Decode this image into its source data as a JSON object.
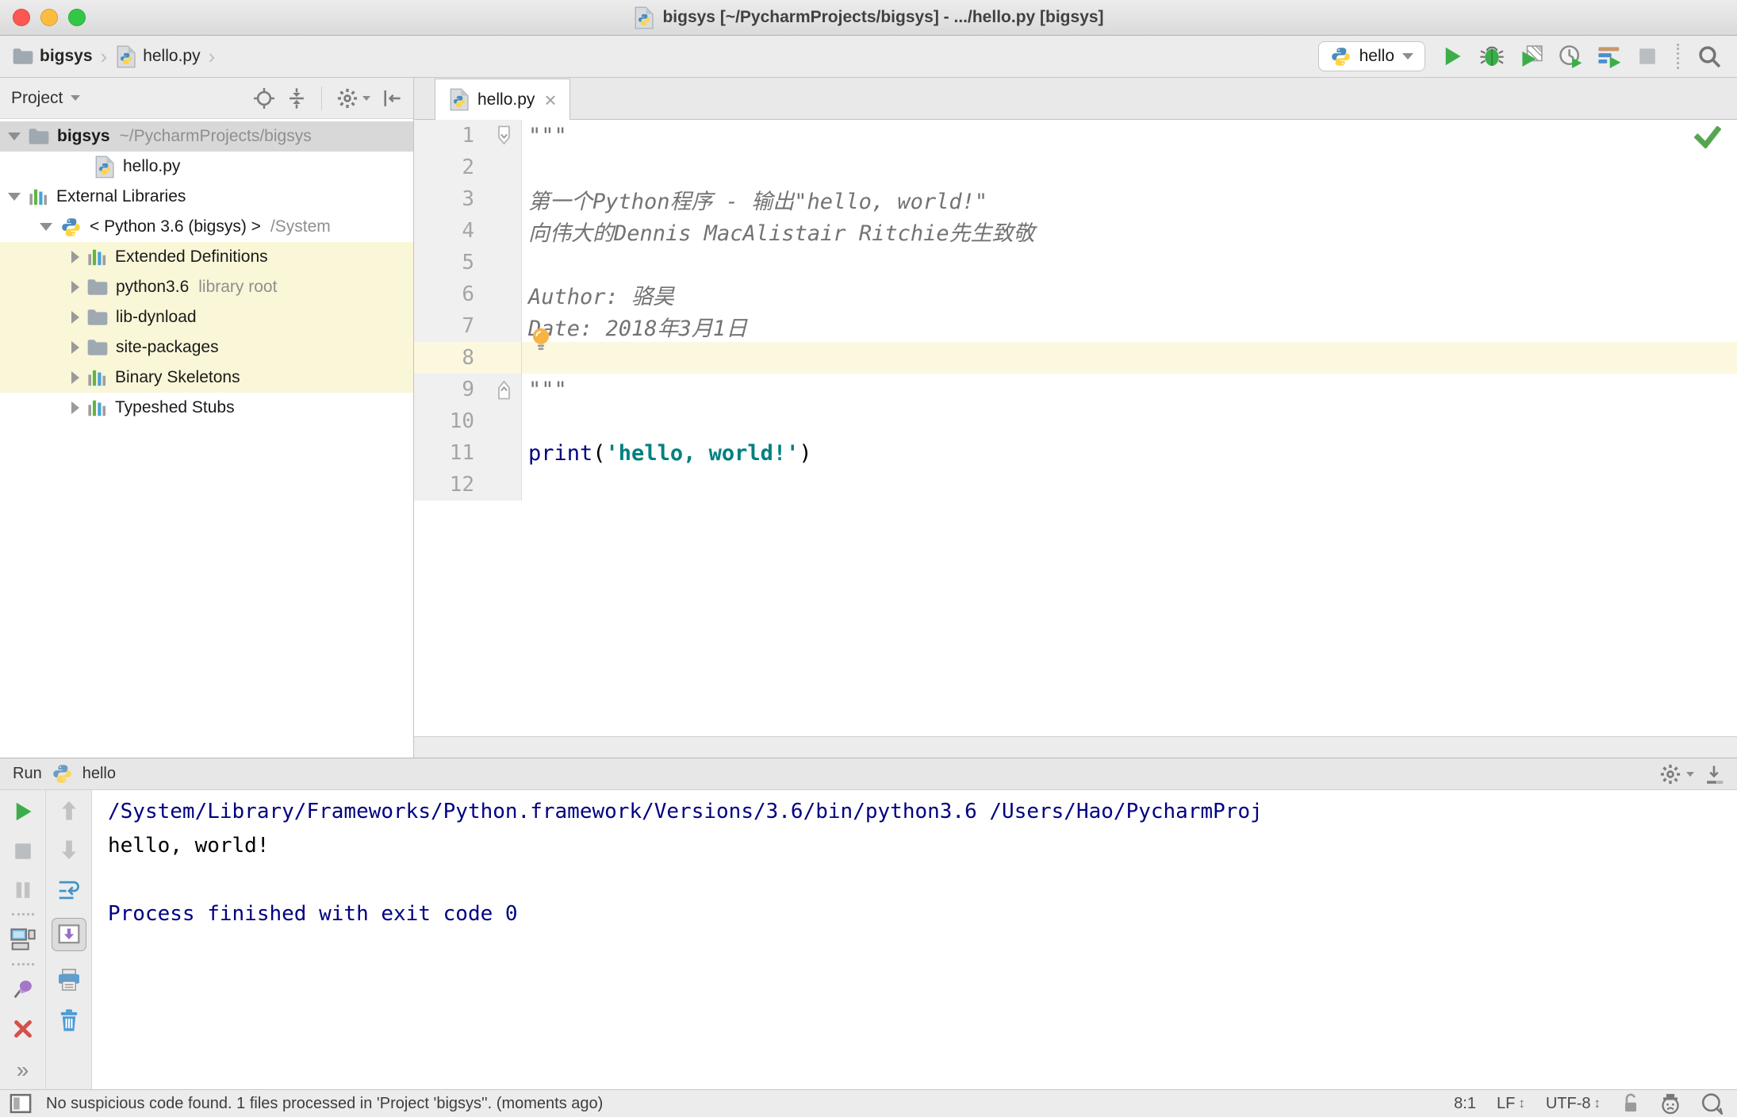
{
  "window": {
    "title": "bigsys [~/PycharmProjects/bigsys] - .../hello.py [bigsys]",
    "traffic_light_colors": {
      "close": "#FC5753",
      "minimize": "#FDBC40",
      "zoom": "#33C748"
    }
  },
  "navbar": {
    "breadcrumbs": [
      {
        "label": "bigsys",
        "icon": "folder",
        "bold": true
      },
      {
        "label": "hello.py",
        "icon": "pyfile",
        "bold": false
      }
    ],
    "separator": "›",
    "run_config": {
      "icon": "python",
      "label": "hello"
    },
    "action_icons": [
      "run",
      "debug",
      "coverage",
      "profiler",
      "concurrency",
      "stop",
      "|",
      "search"
    ]
  },
  "project_panel": {
    "title": "Project",
    "header_icons": [
      "locate",
      "collapse-all",
      "|",
      "settings",
      "hide-panel"
    ],
    "tree": [
      {
        "label": "bigsys",
        "suffix": "~/PycharmProjects/bigsys",
        "icon": "folder",
        "level": 0,
        "chevron": "down",
        "selected": true,
        "bold": true
      },
      {
        "label": "hello.py",
        "icon": "pyfile",
        "level": 1,
        "chevron": "none",
        "extra_indent": true
      },
      {
        "label": "External Libraries",
        "icon": "library",
        "level": 0,
        "chevron": "down"
      },
      {
        "label": "< Python 3.6 (bigsys) >",
        "suffix": "/System",
        "icon": "python",
        "level": 1,
        "chevron": "down"
      },
      {
        "label": "Extended Definitions",
        "icon": "library",
        "level": 2,
        "chevron": "right",
        "highlight": true
      },
      {
        "label": "python3.6",
        "suffix": "library root",
        "icon": "folder",
        "level": 2,
        "chevron": "right",
        "highlight": true
      },
      {
        "label": "lib-dynload",
        "icon": "folder",
        "level": 2,
        "chevron": "right",
        "highlight": true
      },
      {
        "label": "site-packages",
        "icon": "folder",
        "level": 2,
        "chevron": "right",
        "highlight": true
      },
      {
        "label": "Binary Skeletons",
        "icon": "library",
        "level": 2,
        "chevron": "right",
        "highlight": true
      },
      {
        "label": "Typeshed Stubs",
        "icon": "library",
        "level": 2,
        "chevron": "right"
      }
    ]
  },
  "editor": {
    "tab": {
      "icon": "pyfile",
      "label": "hello.py",
      "close": "×"
    },
    "inspection_ok_icon": "check",
    "lines": [
      {
        "n": 1,
        "fold": "fold-open",
        "tokens": [
          {
            "t": "\"\"\"",
            "s": "doc"
          }
        ]
      },
      {
        "n": 2,
        "tokens": []
      },
      {
        "n": 3,
        "tokens": [
          {
            "t": "第一个Python程序 - 输出\"hello, world!\"",
            "s": "doc"
          }
        ]
      },
      {
        "n": 4,
        "tokens": [
          {
            "t": "向伟大的Dennis MacAlistair Ritchie先生致敬",
            "s": "doc"
          }
        ]
      },
      {
        "n": 5,
        "tokens": []
      },
      {
        "n": 6,
        "tokens": [
          {
            "t": "Author: 骆昊",
            "s": "doc"
          }
        ]
      },
      {
        "n": 7,
        "tokens": [
          {
            "t": "Date: 2018年3月1日",
            "s": "doc"
          }
        ],
        "bulb": true
      },
      {
        "n": 8,
        "tokens": [],
        "current": true
      },
      {
        "n": 9,
        "fold": "fold-close",
        "tokens": [
          {
            "t": "\"\"\"",
            "s": "doc"
          }
        ]
      },
      {
        "n": 10,
        "tokens": []
      },
      {
        "n": 11,
        "tokens": [
          {
            "t": "print",
            "s": "kw"
          },
          {
            "t": "(",
            "s": "plain"
          },
          {
            "t": "'hello, world!'",
            "s": "str"
          },
          {
            "t": ")",
            "s": "plain"
          }
        ]
      },
      {
        "n": 12,
        "tokens": []
      }
    ]
  },
  "run_panel": {
    "title": "Run",
    "config_icon": "python",
    "config_label": "hello",
    "header_icons": [
      "settings",
      "hide-down"
    ],
    "toolbar_col1": [
      "rerun",
      "stop",
      "pause",
      "...",
      "layout",
      "...",
      "pin",
      "close-red"
    ],
    "toolbar_more": "»",
    "toolbar_col2": [
      "arrow-up",
      "arrow-down",
      "softwrap",
      "scrollend",
      "printer",
      "trash"
    ],
    "console": [
      {
        "text": "/System/Library/Frameworks/Python.framework/Versions/3.6/bin/python3.6 /Users/Hao/PycharmProj",
        "style": "sys"
      },
      {
        "text": "hello, world!",
        "style": "out"
      },
      {
        "text": "",
        "style": "out"
      },
      {
        "text": "Process finished with exit code 0",
        "style": "sys"
      }
    ]
  },
  "status_bar": {
    "message": "No suspicious code found. 1 files processed in 'Project 'bigsys''. (moments ago)",
    "caret": "8:1",
    "line_separator": "LF",
    "encoding": "UTF-8",
    "updown": "↕",
    "right_icons": [
      "lock-open",
      "hector",
      "bubble"
    ]
  }
}
